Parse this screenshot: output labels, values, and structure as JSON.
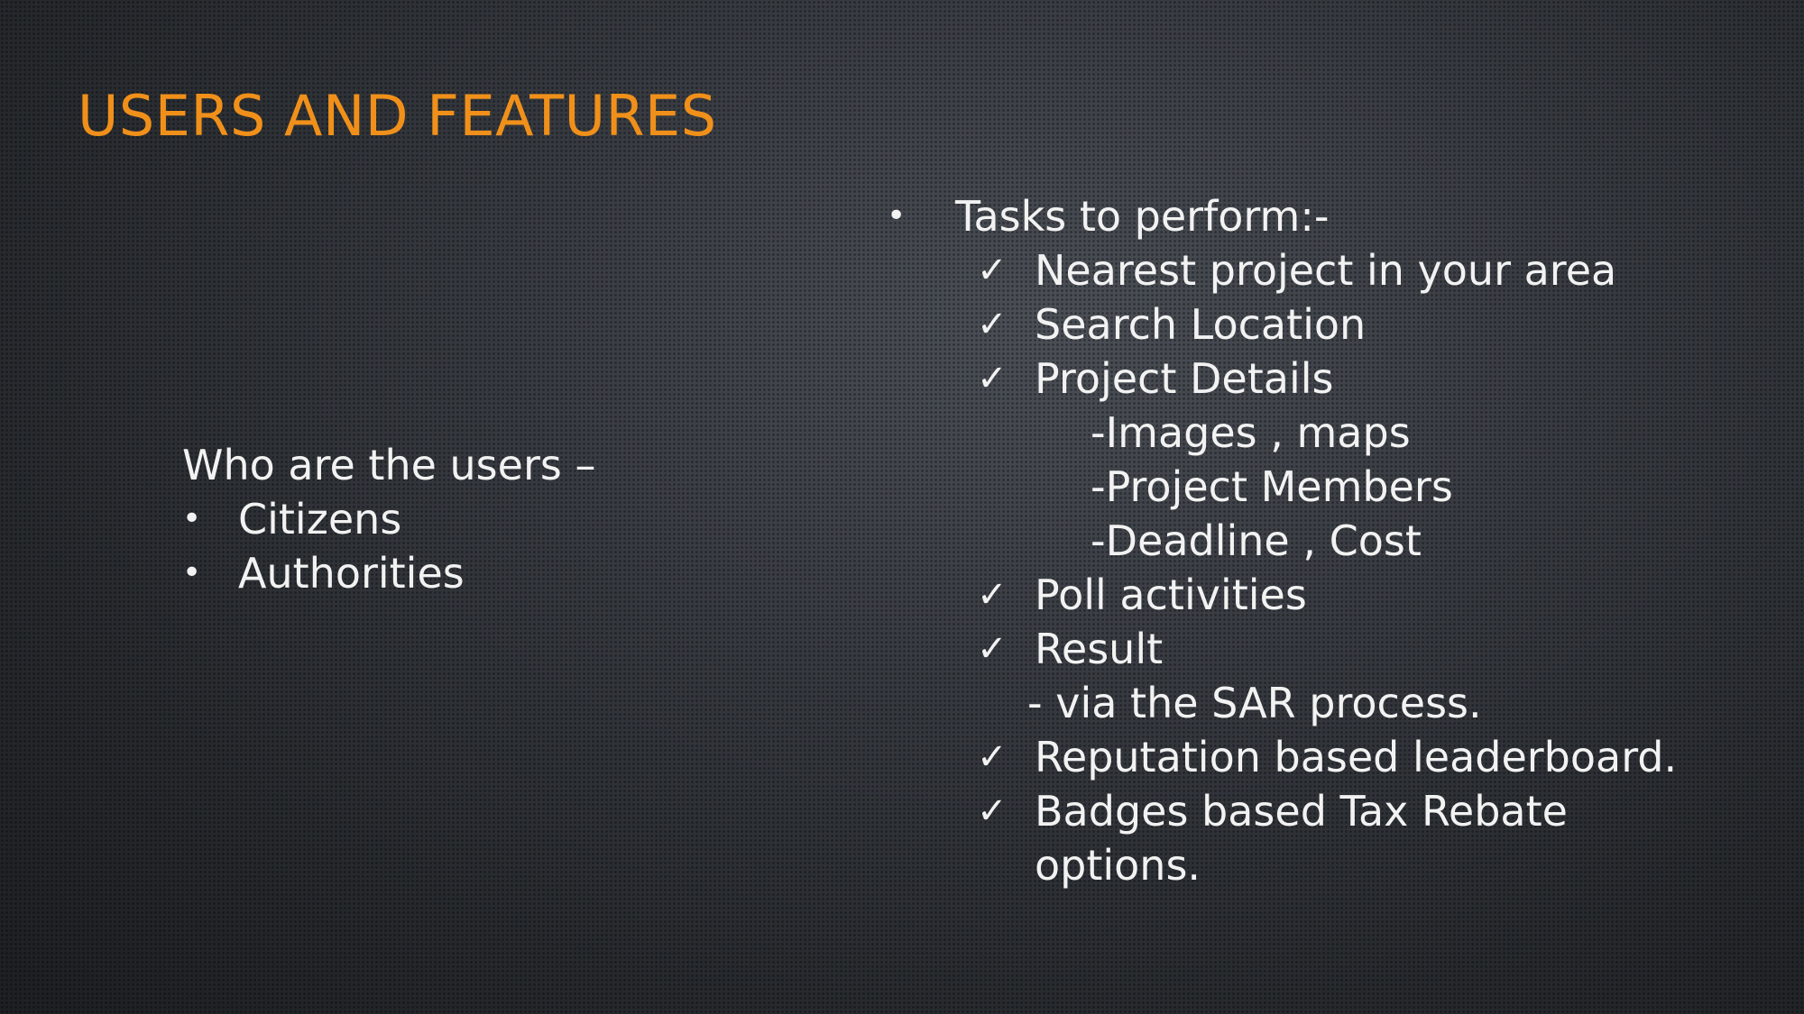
{
  "title": "USERS AND FEATURES",
  "left": {
    "heading": "Who are the users –",
    "bullet_glyph": "•",
    "items": [
      "Citizens",
      "Authorities"
    ]
  },
  "right": {
    "bullet_glyph": "•",
    "check_glyph": "✓",
    "heading": "Tasks to perform:-",
    "lines": {
      "nearest": "Nearest project in your area",
      "search": "Search Location",
      "details": "Project Details",
      "images": "-Images , maps",
      "members": "-Project Members",
      "deadline": "-Deadline , Cost",
      "poll": "Poll activities",
      "result": "Result",
      "sar": "- via the SAR process.",
      "reputation": "Reputation based leaderboard.",
      "badges": "Badges based Tax Rebate",
      "options": "options."
    }
  }
}
